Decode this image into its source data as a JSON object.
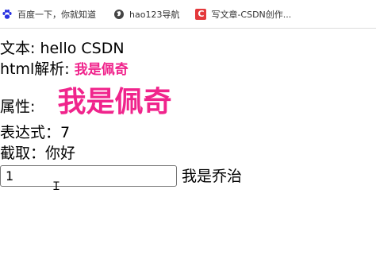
{
  "bookmarks": [
    {
      "label": "百度一下，你就知道",
      "icon": "baidu-paw-icon"
    },
    {
      "label": "hao123导航",
      "icon": "globe-icon"
    },
    {
      "label": "写文章-CSDN创作...",
      "icon": "csdn-logo-icon"
    }
  ],
  "page": {
    "text_line": "文本: hello CSDN",
    "html_label": "html解析: ",
    "html_value": "我是佩奇",
    "attr_label": "属性: ",
    "attr_value": "我是佩奇",
    "expr_line": "表达式：7",
    "slice_line": "截取：你好",
    "input_value": "1",
    "after_input": "我是乔治"
  },
  "colors": {
    "accent_pink": "#f0248c",
    "csdn_red": "#e4393c"
  }
}
